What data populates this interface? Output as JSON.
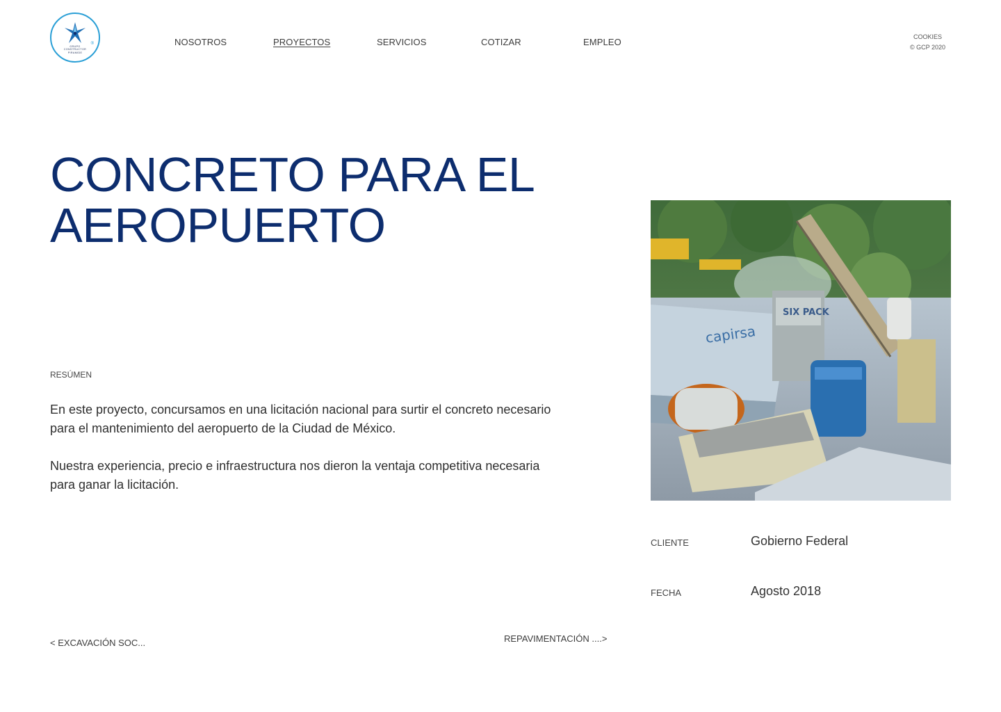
{
  "logo": {
    "line1": "GRUPO",
    "line2": "CONSTRUCTOR",
    "line3": "PIRAMIDE",
    "mark": "®"
  },
  "nav": [
    {
      "label": "NOSOTROS"
    },
    {
      "label": "PROYECTOS",
      "active": true
    },
    {
      "label": "SERVICIOS"
    },
    {
      "label": "COTIZAR"
    },
    {
      "label": "EMPLEO"
    }
  ],
  "meta": {
    "cookies": "COOKIES",
    "copyright": "© GCP 2020"
  },
  "project": {
    "title_line1": "CONCRETO PARA EL",
    "title_line2": "AEROPUERTO",
    "summary_label": "RESÚMEN",
    "paragraphs": [
      "En este proyecto, concursamos en una licitación nacional para surtir el concreto necesario para el mantenimiento del aeropuerto de la Ciudad de México.",
      "Nuestra experiencia, precio e infraestructura nos dieron la ventaja competitiva necesaria para ganar la licitación."
    ],
    "photo_signs": {
      "sign1": "capirsa",
      "sign2": "SIX PACK"
    },
    "details": {
      "client_label": "CLIENTE",
      "client_value": "Gobierno Federal",
      "date_label": "FECHA",
      "date_value": "Agosto 2018"
    }
  },
  "pager": {
    "prev": "< EXCAVACIÓN SOC...",
    "next": "REPAVIMENTACIÓN ....>"
  },
  "colors": {
    "title": "#0d2d6e",
    "logo_ring": "#2a9fd6"
  }
}
